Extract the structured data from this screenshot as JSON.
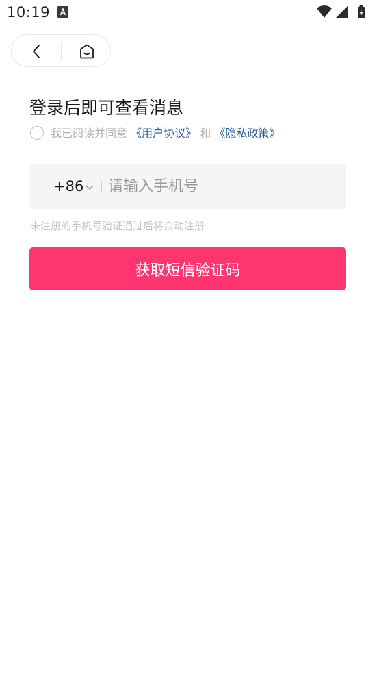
{
  "status_bar": {
    "time": "10:19",
    "notification_icon": "a-icon",
    "icons": [
      "wifi-icon",
      "signal-icon",
      "battery-charging-icon"
    ]
  },
  "nav": {
    "back_icon": "chevron-left-icon",
    "home_icon": "home-icon"
  },
  "title": "登录后即可查看消息",
  "agreement": {
    "checked": false,
    "prefix": "我已阅读并同意",
    "user_agreement": "《用户协议》",
    "conjunction": "和",
    "privacy_policy": "《隐私政策》"
  },
  "phone": {
    "country_code": "+86",
    "placeholder": "请输入手机号",
    "value": ""
  },
  "hint": "未注册的手机号验证通过后将自动注册",
  "submit_label": "获取短信验证码",
  "colors": {
    "accent": "#fd3670",
    "link": "#245a9a",
    "input_bg": "#f5f5f5"
  }
}
